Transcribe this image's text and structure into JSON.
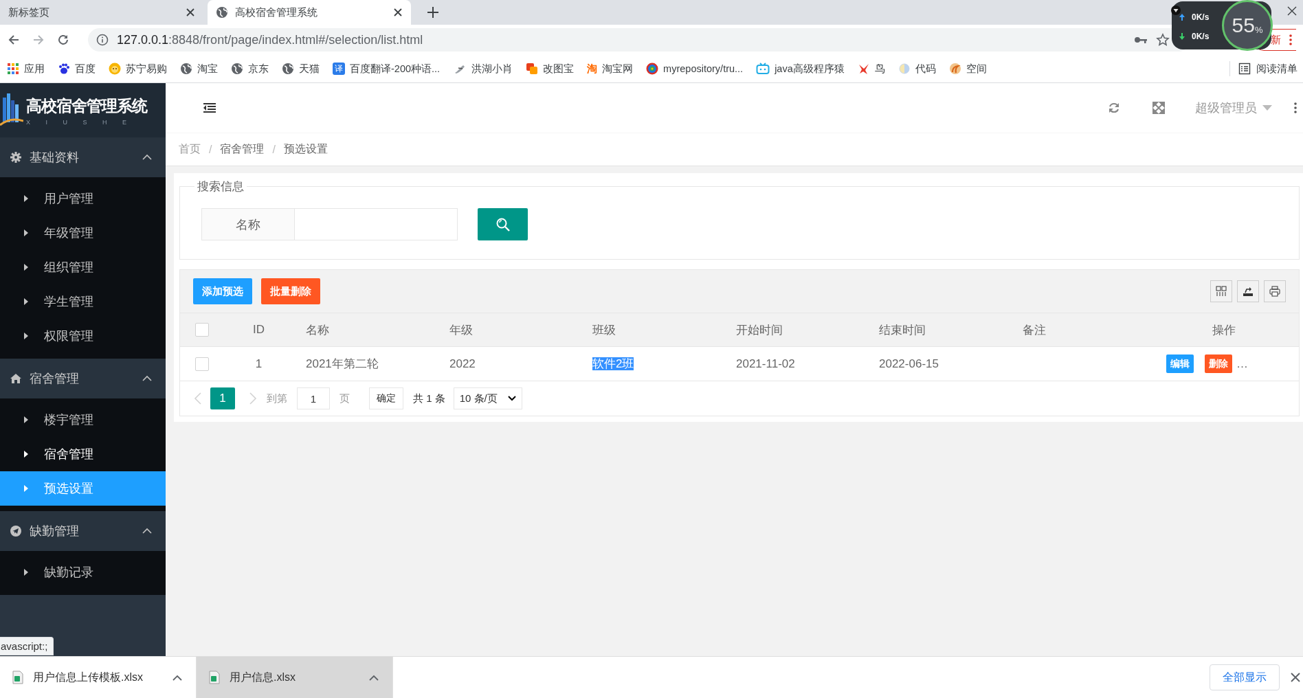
{
  "browser": {
    "tabs": [
      {
        "title": "新标签页",
        "selected": false
      },
      {
        "title": "高校宿舍管理系统",
        "selected": true
      }
    ],
    "address": {
      "host": "127.0.0.1",
      "path": ":8848/front/page/index.html#/selection/list.html"
    },
    "update_button": "新",
    "bookmarks": [
      {
        "label": "应用"
      },
      {
        "label": "百度"
      },
      {
        "label": "苏宁易购"
      },
      {
        "label": "淘宝"
      },
      {
        "label": "京东"
      },
      {
        "label": "天猫"
      },
      {
        "label": "百度翻译-200种语...",
        "icon_text": "译"
      },
      {
        "label": "洪湖小肖"
      },
      {
        "label": "改图宝"
      },
      {
        "label": "淘宝网",
        "icon_text": "淘"
      },
      {
        "label": "myrepository/tru..."
      },
      {
        "label": "java高级程序猿"
      },
      {
        "label": "鸟"
      },
      {
        "label": "代码"
      },
      {
        "label": "空间"
      }
    ],
    "reading_list": "阅读清单"
  },
  "net_monitor": {
    "upload": "0K/s",
    "download": "0K/s",
    "percent": "55",
    "percent_unit": "%"
  },
  "app": {
    "logo": {
      "title": "高校宿舍管理系统",
      "subtitle": "X I U S H E"
    },
    "sidebar": [
      {
        "label": "基础资料",
        "expanded": true,
        "children": [
          {
            "label": "用户管理",
            "selected": false,
            "hovered": false
          },
          {
            "label": "年级管理",
            "selected": false,
            "hovered": false
          },
          {
            "label": "组织管理",
            "selected": false,
            "hovered": false
          },
          {
            "label": "学生管理",
            "selected": false,
            "hovered": false
          },
          {
            "label": "权限管理",
            "selected": false,
            "hovered": false
          }
        ]
      },
      {
        "label": "宿舍管理",
        "expanded": true,
        "children": [
          {
            "label": "楼宇管理",
            "selected": false,
            "hovered": false
          },
          {
            "label": "宿舍管理",
            "selected": false,
            "hovered": true
          },
          {
            "label": "预选设置",
            "selected": true,
            "hovered": false
          }
        ]
      },
      {
        "label": "缺勤管理",
        "expanded": true,
        "children": [
          {
            "label": "缺勤记录",
            "selected": false,
            "hovered": false
          }
        ]
      }
    ],
    "header": {
      "user": "超级管理员"
    },
    "breadcrumb": {
      "separator": "/",
      "items": [
        "首页",
        "宿舍管理",
        "预选设置"
      ]
    },
    "search": {
      "legend": "搜索信息",
      "field_label": "名称"
    },
    "table": {
      "buttons": [
        {
          "label": "添加预选",
          "kind": "primary"
        },
        {
          "label": "批量删除",
          "kind": "danger"
        }
      ],
      "header_checked": false,
      "columns": [
        "ID",
        "名称",
        "年级",
        "班级",
        "开始时间",
        "结束时间",
        "备注",
        "操作"
      ],
      "rows": [
        {
          "checked": false,
          "id": "1",
          "name": "2021年第二轮",
          "grade": "2022",
          "class": {
            "text": "软件2班",
            "text_selected": true
          },
          "start": "2021-11-02",
          "end": "2022-06-15",
          "actions": [
            {
              "label": "编辑",
              "kind": "edit"
            },
            {
              "label": "删除",
              "kind": "delete"
            }
          ],
          "more": "…"
        }
      ],
      "pagination": {
        "prev_disabled": true,
        "pages": [
          {
            "label": "1",
            "selected": true
          }
        ],
        "next_disabled": true,
        "goto_label": "到第",
        "goto_value": "1",
        "page_unit": "页",
        "confirm": "确定",
        "total": "共 1 条",
        "page_size": "10 条/页"
      }
    }
  },
  "status_tooltip": "avascript:;",
  "downloads": {
    "items": [
      {
        "name": "用户信息上传模板.xlsx",
        "hovered": false
      },
      {
        "name": "用户信息.xlsx",
        "hovered": true
      }
    ],
    "show_all": "全部显示"
  }
}
